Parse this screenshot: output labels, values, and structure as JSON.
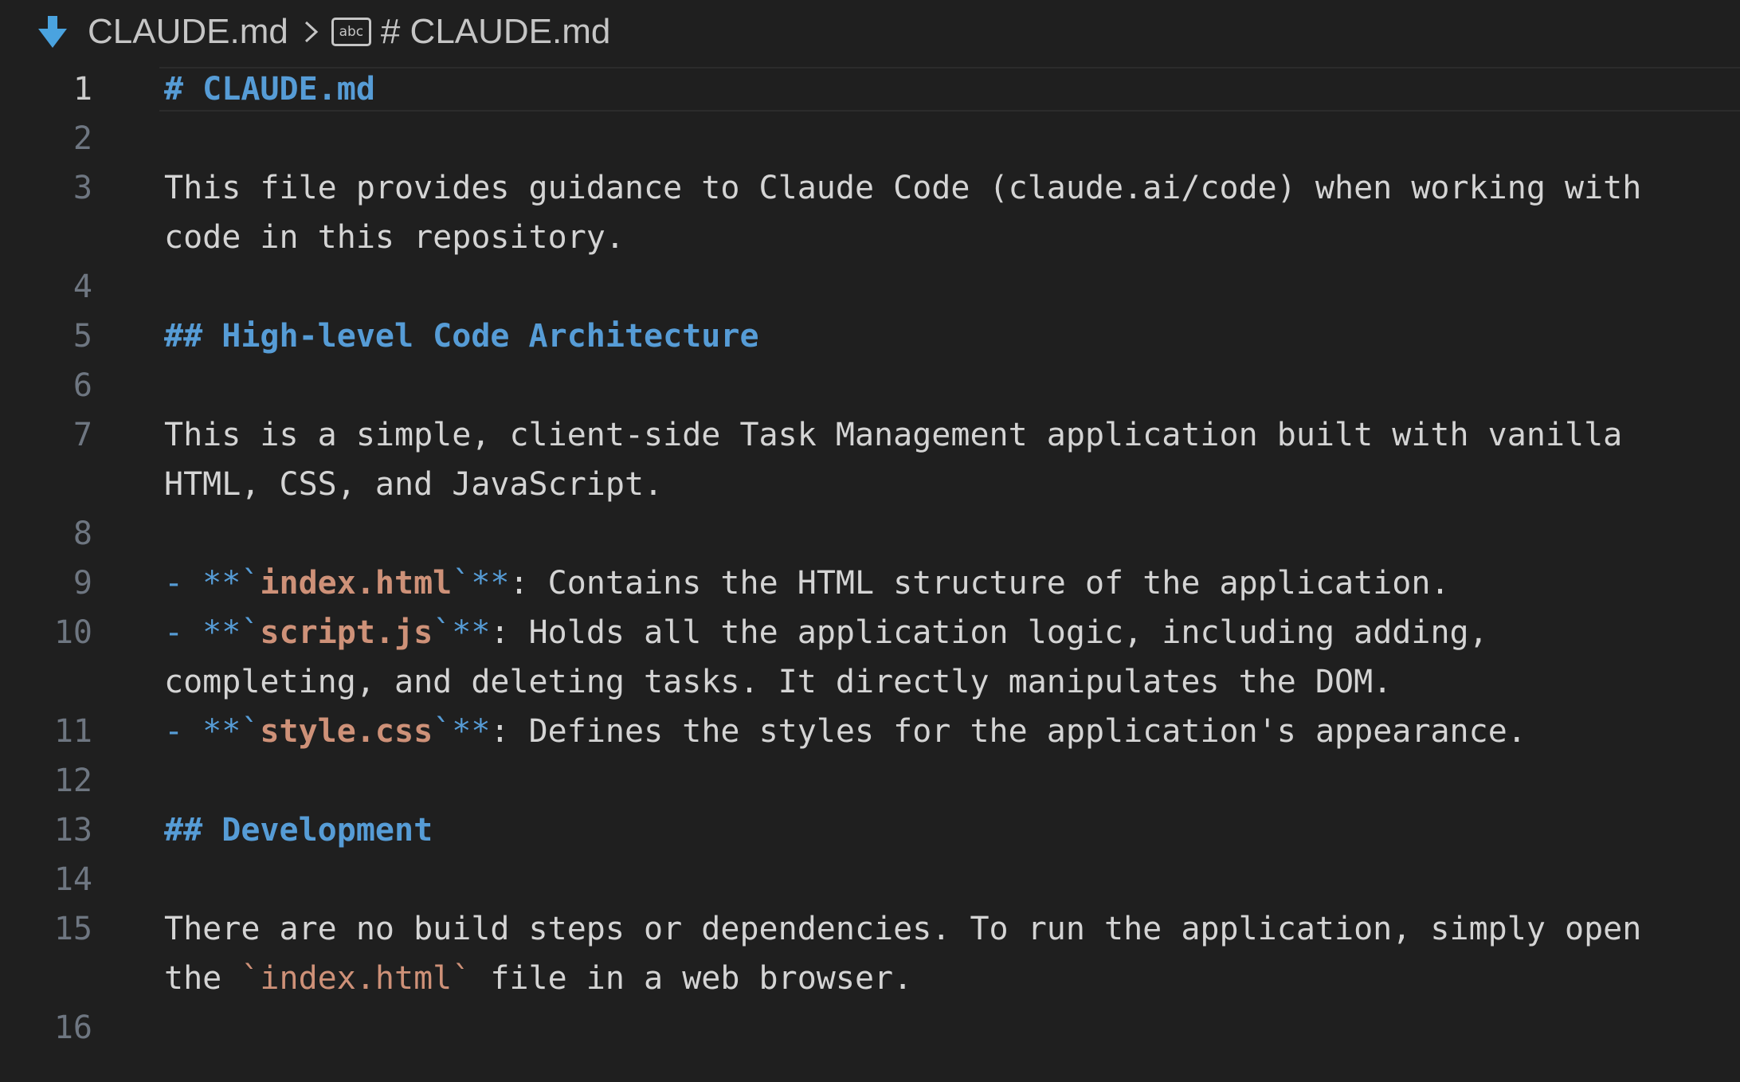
{
  "breadcrumb": {
    "file": "CLAUDE.md",
    "separator": ">",
    "symbol_icon_text": "abc",
    "symbol": "# CLAUDE.md"
  },
  "colors": {
    "background": "#1f1f1f",
    "heading": "#569cd6",
    "string": "#ce9178",
    "text": "#d4d4d4",
    "line_number": "#6e7681",
    "file_icon": "#4aa3df"
  },
  "editor": {
    "active_line": "1",
    "lines": [
      {
        "num": "1",
        "heading": "# CLAUDE.md"
      },
      {
        "num": "2"
      },
      {
        "num": "3",
        "text1": "This file provides guidance to Claude Code (claude.ai/code) when working with",
        "text2": "code in this repository."
      },
      {
        "num": "4"
      },
      {
        "num": "5",
        "heading": "## High-level Code Architecture"
      },
      {
        "num": "6"
      },
      {
        "num": "7",
        "text1": "This is a simple, client-side Task Management application built with vanilla",
        "text2": "HTML, CSS, and JavaScript."
      },
      {
        "num": "8"
      },
      {
        "num": "9",
        "bullet": "- **`",
        "file": "index.html",
        "close": "`**",
        "desc": ": Contains the HTML structure of the application."
      },
      {
        "num": "10",
        "bullet": "- **`",
        "file": "script.js",
        "close": "`**",
        "desc": ": Holds all the application logic, including adding,",
        "cont": "completing, and deleting tasks. It directly manipulates the DOM."
      },
      {
        "num": "11",
        "bullet": "- **`",
        "file": "style.css",
        "close": "`**",
        "desc": ": Defines the styles for the application's appearance."
      },
      {
        "num": "12"
      },
      {
        "num": "13",
        "heading": "## Development"
      },
      {
        "num": "14"
      },
      {
        "num": "15",
        "text1": "There are no build steps or dependencies. To run the application, simply open",
        "pre": "the ",
        "code": "`index.html`",
        "post": " file in a web browser."
      },
      {
        "num": "16"
      }
    ]
  }
}
